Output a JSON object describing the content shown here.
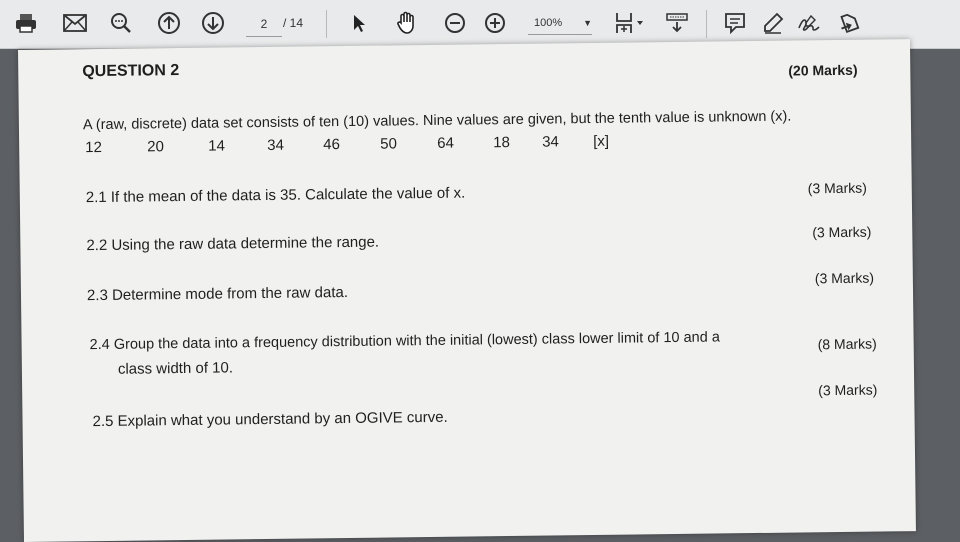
{
  "toolbar": {
    "current_page": "2",
    "total_pages": "/ 14",
    "zoom": "100%",
    "icons": [
      "print-icon",
      "email-icon",
      "comment-search-icon",
      "page-up-icon",
      "page-down-icon",
      "select-arrow-icon",
      "hand-tool-icon",
      "zoom-out-icon",
      "zoom-in-icon",
      "fit-page-icon",
      "keyboard-scroll-icon",
      "comment-icon",
      "highlight-pen-icon",
      "sign-icon",
      "share-icon"
    ]
  },
  "document": {
    "question_title": "QUESTION 2",
    "question_marks": "(20 Marks)",
    "intro": "A (raw, discrete) data set consists of ten (10) values. Nine values are given, but the tenth value is unknown (x).",
    "values": [
      "12",
      "20",
      "14",
      "34",
      "46",
      "50",
      "64",
      "18",
      "34",
      "[x]"
    ],
    "q1": {
      "text": "2.1 If the mean of the data is 35. Calculate the value of x.",
      "marks": "(3 Marks)"
    },
    "q2": {
      "text": "2.2 Using the raw data determine the range.",
      "marks": "(3 Marks)"
    },
    "q3": {
      "text": "2.3 Determine mode from the raw data.",
      "marks": "(3 Marks)"
    },
    "q4": {
      "text_line1": "2.4 Group the data into a frequency distribution with the initial (lowest) class lower limit of 10 and a",
      "text_line2": "class width of 10.",
      "marks": "(8 Marks)"
    },
    "q5": {
      "text": "2.5 Explain what you understand by an OGIVE curve.",
      "marks": "(3 Marks)"
    }
  }
}
